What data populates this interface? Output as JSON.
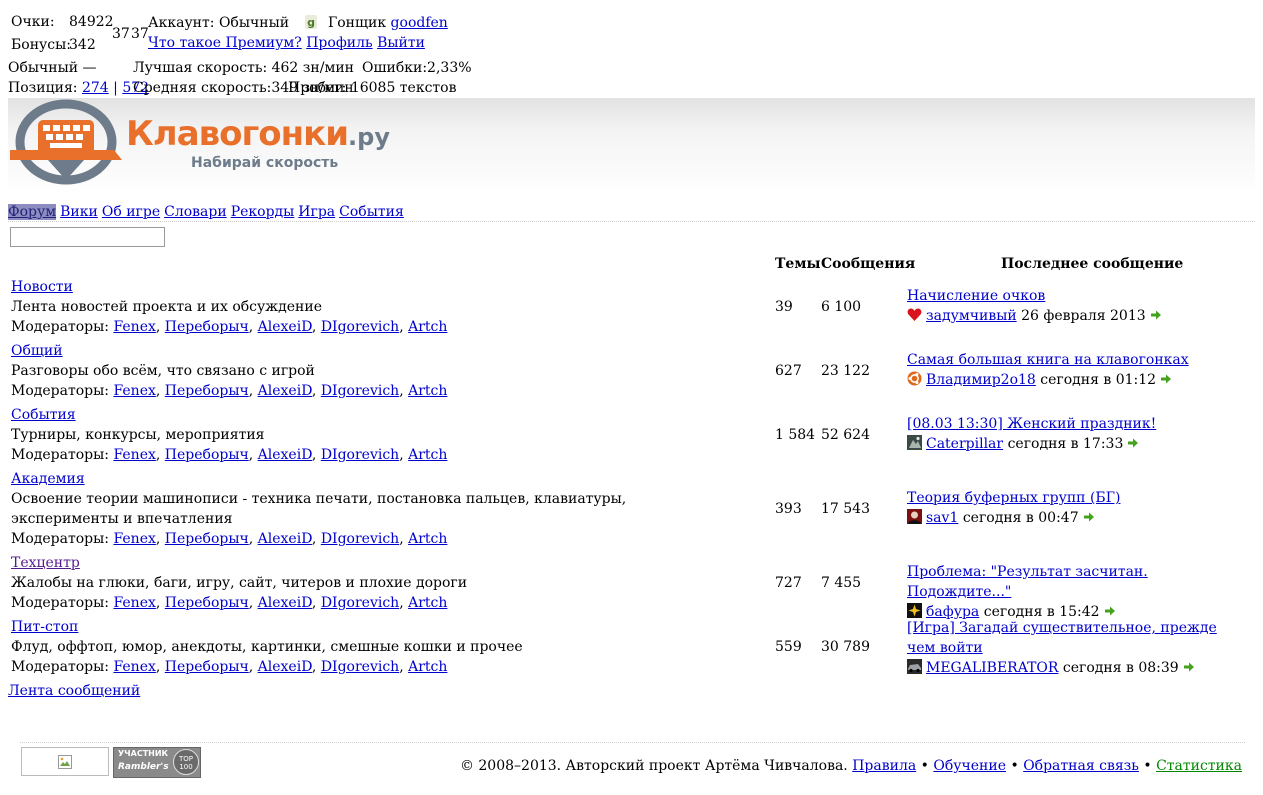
{
  "user_panel": {
    "score_label": "Очки:",
    "score_value": "84922",
    "bonus_label": "Бонусы:",
    "bonus_value": "342",
    "mini_a": "37",
    "mini_b": "37",
    "account_label": "Аккаунт:",
    "account_type": "Обычный",
    "racer_label": "Гонщик",
    "racer_name": "goodfen",
    "premium_link": "Что такое Премиум?",
    "profile_link": "Профиль",
    "logout_link": "Выйти",
    "rank_line": "Обычный —",
    "best_speed": "Лучшая скорость: 462 зн/мин",
    "errors": "Ошибки:2,33%",
    "position_label": "Позиция:",
    "position_a": "274",
    "position_sep": "|",
    "position_b": "572",
    "avg_speed": "Средняя скорость:349 зн/мин",
    "mileage": "Пробег:  16085 текстов"
  },
  "logo": {
    "name": "Клавогонки",
    "tld": ".ру",
    "slogan": "Набирай скорость"
  },
  "menu": [
    {
      "label": "Форум",
      "active": true
    },
    {
      "label": "Вики"
    },
    {
      "label": "Об игре"
    },
    {
      "label": "Словари"
    },
    {
      "label": "Рекорды"
    },
    {
      "label": "Игра"
    },
    {
      "label": "События"
    }
  ],
  "search": {
    "value": ""
  },
  "table": {
    "headers": {
      "topics": "Темы",
      "messages": "Сообщения",
      "last": "Последнее сообщение"
    },
    "moderators_label": "Модераторы:",
    "moderators": [
      "Fenex",
      "Переборыч",
      "AlexeiD",
      "DIgorevich",
      "Artch"
    ],
    "forums": [
      {
        "title": "Новости",
        "desc": "Лента новостей проекта и их обсуждение",
        "topics": "39",
        "messages": "6 100",
        "last_title": "Начисление очков",
        "last_user": "задумчивый",
        "last_time": "26 февраля 2013",
        "avatar": "heart-avatar-icon"
      },
      {
        "title": "Общий",
        "desc": "Разговоры обо всём, что связано с игрой",
        "topics": "627",
        "messages": "23 122",
        "last_title": "Самая большая книга на клавогонках",
        "last_user": "Владимир2о18",
        "last_time": "сегодня в 01:12",
        "avatar": "ubuntu-avatar-icon"
      },
      {
        "title": "События",
        "desc": "Турниры, конкурсы, мероприятия",
        "topics": "1 584",
        "messages": "52 624",
        "last_title": "[08.03 13:30] Женский праздник!",
        "last_user": "Caterpillar",
        "last_time": "сегодня в 17:33",
        "avatar": "photo-avatar-icon"
      },
      {
        "title": "Академия",
        "desc": "Освоение теории машинописи - техника печати, постановка пальцев, клавиатуры, эксперименты и впечатления",
        "topics": "393",
        "messages": "17 543",
        "last_title": "Теория буферных групп (БГ)",
        "last_user": "sav1",
        "last_time": "сегодня в 00:47",
        "avatar": "dark-avatar-icon"
      },
      {
        "title": "Техцентр",
        "desc": "Жалобы на глюки, баги, игру, сайт, читеров и плохие дороги",
        "topics": "727",
        "messages": "7 455",
        "last_title": "Проблема: \"Результат засчитан. Подождите...\"",
        "last_user": "бафура",
        "last_time": "сегодня в 15:42",
        "avatar": "star-avatar-icon"
      },
      {
        "title": "Пит-стоп",
        "desc": "Флуд, оффтоп, юмор, анекдоты, картинки, смешные кошки и прочее",
        "topics": "559",
        "messages": "30 789",
        "last_title": "[Игра] Загадай существительное, прежде чем войти",
        "last_user": "MEGALIBERATOR",
        "last_time": "сегодня в 08:39",
        "avatar": "car-avatar-icon"
      }
    ],
    "feed_link": "Лента сообщений"
  },
  "footer": {
    "rambler_top": "УЧАСТНИК",
    "rambler_brand": "Rambler's",
    "rambler_badge": "TOP 100",
    "copyright": "© 2008–2013. Авторский проект Артёма Чивчалова.",
    "links": [
      "Правила",
      "Обучение",
      "Обратная связь",
      "Статистика"
    ],
    "separator": "•"
  },
  "colors": {
    "link": "#0000cc",
    "visited": "#551a8b",
    "logo_orange": "#e8702a",
    "logo_gray": "#6d7b8a",
    "stat_link": "#008800"
  }
}
